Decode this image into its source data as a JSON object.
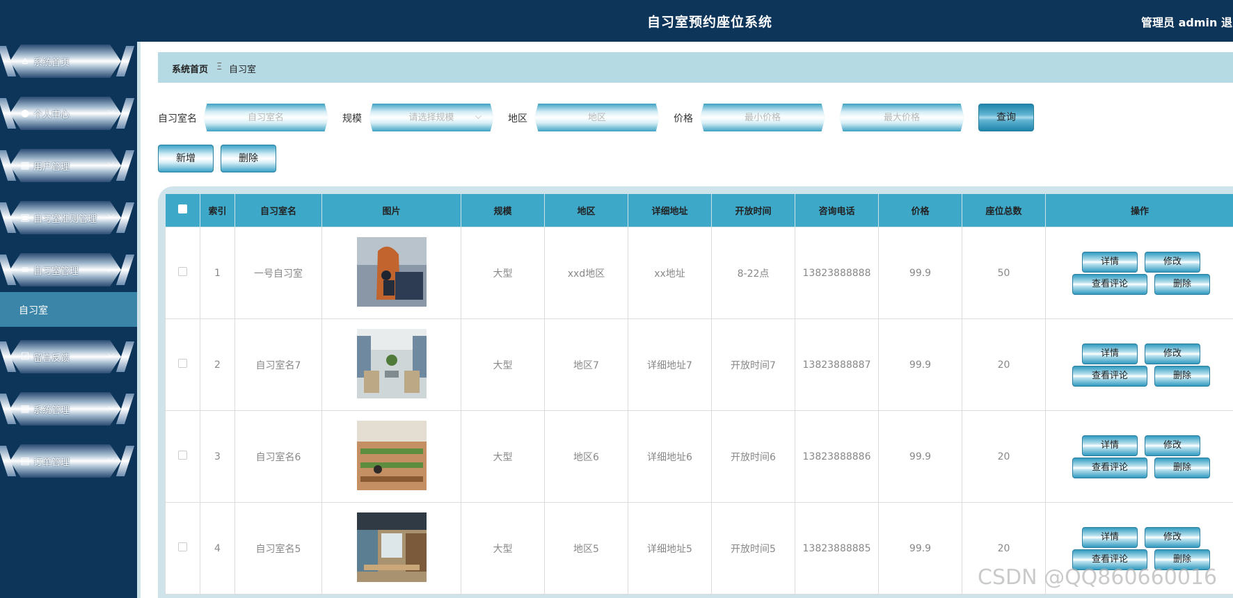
{
  "header": {
    "title": "自习室预约座位系统",
    "user": "管理员 admin  退出"
  },
  "sidebar": {
    "items": [
      {
        "label": "系统首页",
        "icon": "home-icon",
        "chevron": ""
      },
      {
        "label": "个人中心",
        "icon": "user-icon",
        "chevron": "⌵"
      },
      {
        "label": "用户管理",
        "icon": "grid-icon",
        "chevron": "⌵"
      },
      {
        "label": "自习室准则管理",
        "icon": "briefcase-icon",
        "chevron": "⌵"
      },
      {
        "label": "自习室管理",
        "icon": "sliders-icon",
        "chevron": "︿"
      },
      {
        "label": "留言反馈",
        "icon": "clipboard-check-icon",
        "chevron": "⌵"
      },
      {
        "label": "系统管理",
        "icon": "grid-icon",
        "chevron": "⌵"
      },
      {
        "label": "订单管理",
        "icon": "chat-icon",
        "chevron": "⌵"
      }
    ],
    "active_sub": "自习室"
  },
  "breadcrumb": {
    "home": "系统首页",
    "sep": "Ξ",
    "current": "自习室"
  },
  "search": {
    "name_label": "自习室名",
    "name_placeholder": "自习室名",
    "scale_label": "规模",
    "scale_placeholder": "请选择规模",
    "area_label": "地区",
    "area_placeholder": "地区",
    "price_label": "价格",
    "min_placeholder": "最小价格",
    "max_placeholder": "最大价格",
    "query": "查询"
  },
  "actions": {
    "add": "新增",
    "delete": "删除"
  },
  "table": {
    "columns": [
      "",
      "索引",
      "自习室名",
      "图片",
      "规模",
      "地区",
      "详细地址",
      "开放时间",
      "咨询电话",
      "价格",
      "座位总数",
      "操作"
    ],
    "rows": [
      {
        "index": "1",
        "name": "一号自习室",
        "scale": "大型",
        "area": "xxd地区",
        "address": "xx地址",
        "hours": "8-22点",
        "phone": "13823888888",
        "price": "99.9",
        "seats": "50"
      },
      {
        "index": "2",
        "name": "自习室名7",
        "scale": "大型",
        "area": "地区7",
        "address": "详细地址7",
        "hours": "开放时间7",
        "phone": "13823888887",
        "price": "99.9",
        "seats": "20"
      },
      {
        "index": "3",
        "name": "自习室名6",
        "scale": "大型",
        "area": "地区6",
        "address": "详细地址6",
        "hours": "开放时间6",
        "phone": "13823888886",
        "price": "99.9",
        "seats": "20"
      },
      {
        "index": "4",
        "name": "自习室名5",
        "scale": "大型",
        "area": "地区5",
        "address": "详细地址5",
        "hours": "开放时间5",
        "phone": "13823888885",
        "price": "99.9",
        "seats": "20"
      }
    ],
    "ops": {
      "detail": "详情",
      "edit": "修改",
      "comments": "查看评论",
      "delete": "删除"
    }
  },
  "watermark": "CSDN @QQ860660016"
}
